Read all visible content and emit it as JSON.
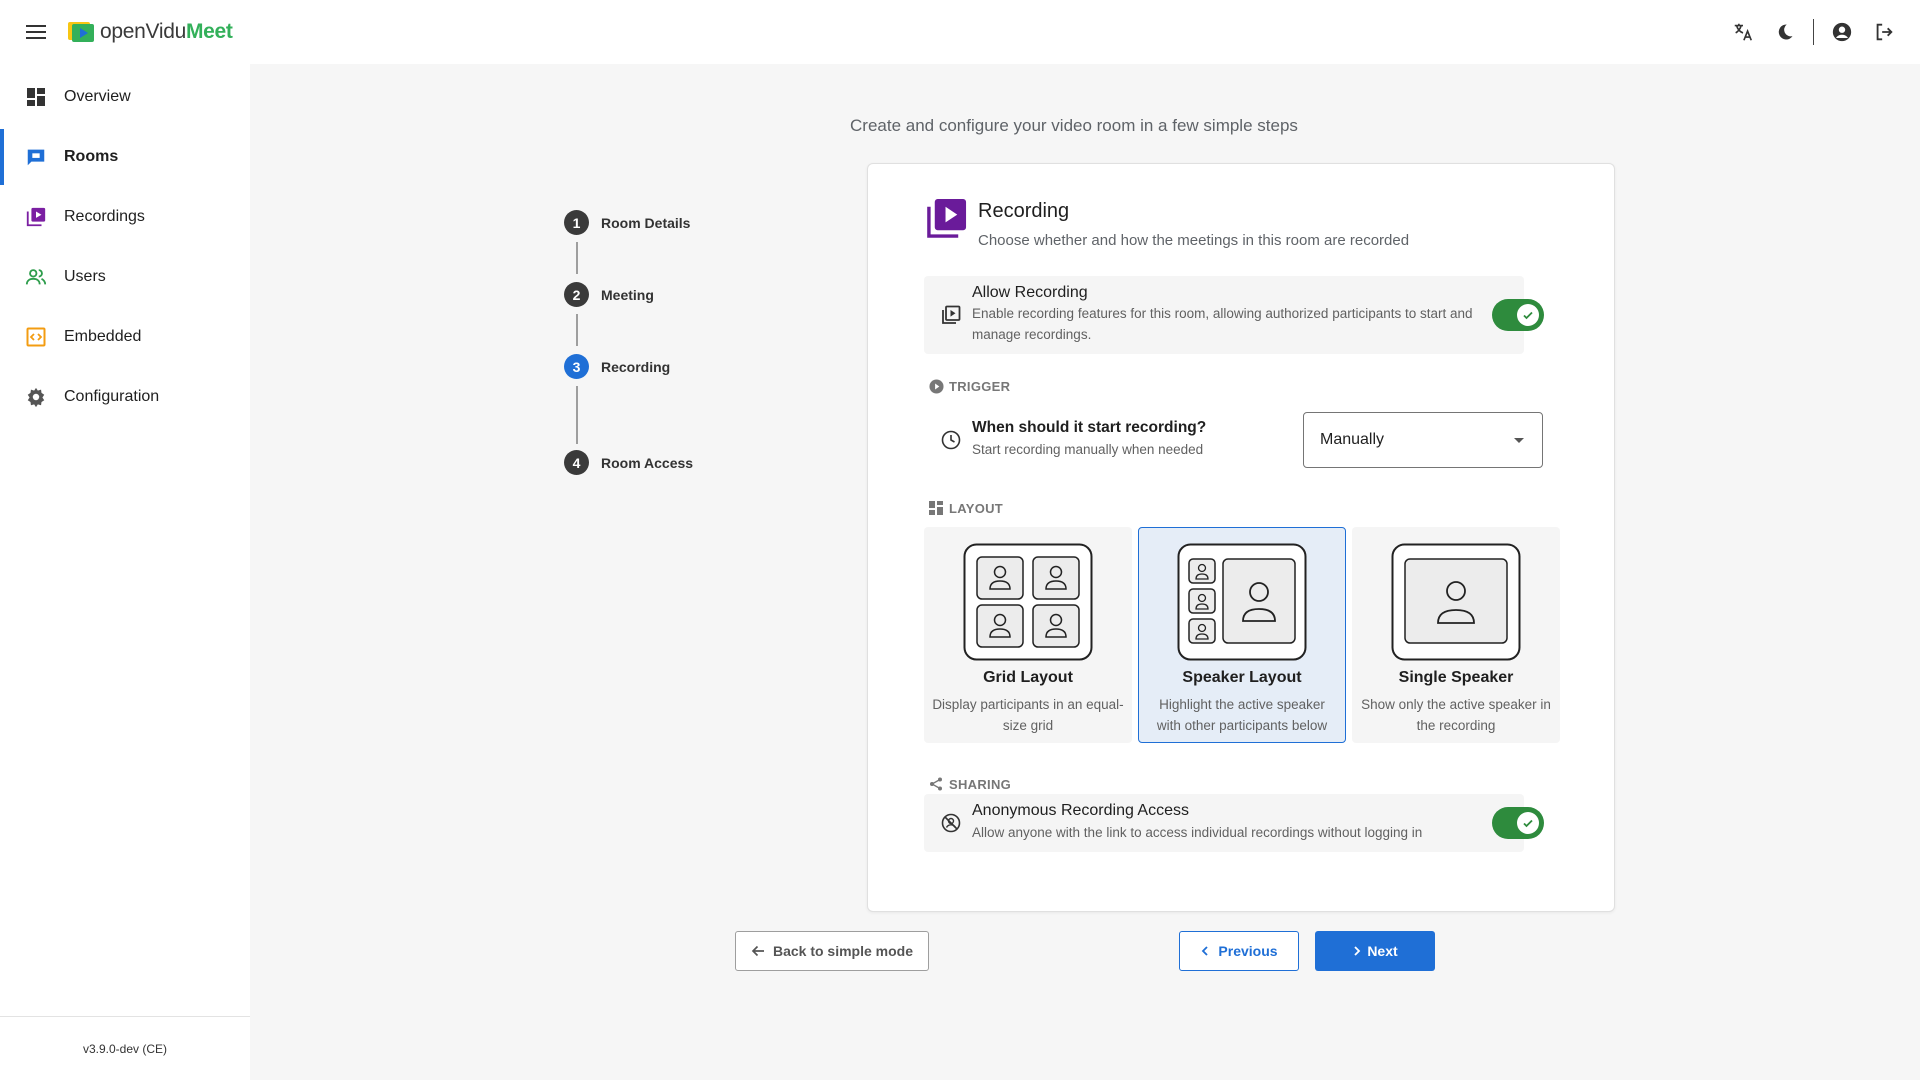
{
  "app": {
    "logo_part1": "openVidu",
    "logo_part2": "Meet",
    "version": "v3.9.0-dev (CE)"
  },
  "sidebar": {
    "items": [
      {
        "label": "Overview",
        "icon": "dashboard-icon"
      },
      {
        "label": "Rooms",
        "icon": "chat-icon",
        "active": true
      },
      {
        "label": "Recordings",
        "icon": "video-library-icon"
      },
      {
        "label": "Users",
        "icon": "users-icon"
      },
      {
        "label": "Embedded",
        "icon": "code-icon"
      },
      {
        "label": "Configuration",
        "icon": "gear-icon"
      }
    ]
  },
  "page": {
    "subtitle": "Create and configure your video room in a few simple steps"
  },
  "stepper": {
    "steps": [
      {
        "number": "1",
        "label": "Room Details"
      },
      {
        "number": "2",
        "label": "Meeting"
      },
      {
        "number": "3",
        "label": "Recording",
        "current": true
      },
      {
        "number": "4",
        "label": "Room Access"
      }
    ]
  },
  "card": {
    "title": "Recording",
    "description": "Choose whether and how the meetings in this room are recorded",
    "allow_recording": {
      "title": "Allow Recording",
      "description": "Enable recording features for this room, allowing authorized participants to start and manage recordings.",
      "enabled": true
    },
    "trigger": {
      "section_label": "TRIGGER",
      "question": "When should it start recording?",
      "hint": "Start recording manually when needed",
      "selected": "Manually"
    },
    "layout": {
      "section_label": "LAYOUT",
      "options": [
        {
          "title": "Grid Layout",
          "description": "Display participants in an equal-size grid"
        },
        {
          "title": "Speaker Layout",
          "description": "Highlight the active speaker with other participants below",
          "selected": true
        },
        {
          "title": "Single Speaker",
          "description": "Show only the active speaker in the recording"
        }
      ]
    },
    "sharing": {
      "section_label": "SHARING",
      "title": "Anonymous Recording Access",
      "description": "Allow anyone with the link to access individual recordings without logging in",
      "enabled": true
    }
  },
  "buttons": {
    "back": "Back to simple mode",
    "previous": "Previous",
    "next": "Next"
  },
  "colors": {
    "primary": "#1f6fd6",
    "toggle_on": "#2e8b3d",
    "recording_purple": "#6a1b9a"
  }
}
